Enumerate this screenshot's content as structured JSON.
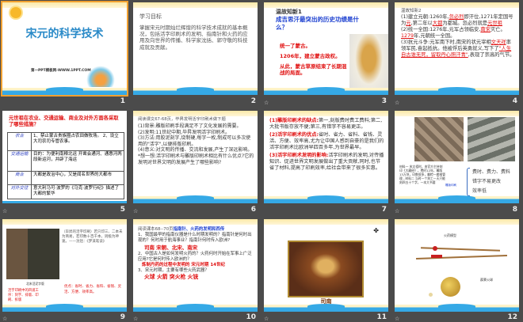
{
  "slides": [
    {
      "number": "1",
      "title": "宋元的科学技术",
      "subtitle": "第一PPT模板网-WWW.1PPT.COM"
    },
    {
      "number": "2",
      "bullets": [
        "学习目标",
        "掌握宋元时期灿烂辉煌的科学技术成就的基本概况，包括活字印刷术的发明、指南针和火药的应用及向世界的传播、科学家沈括、郭守敬的科技成就及贡献。"
      ]
    },
    {
      "number": "3",
      "heading": "温故知新1",
      "question": "成吉思汗最突出的历史功绩是什么？",
      "bullets": [
        "统一了蒙古。",
        "1206年，建立蒙古政权。",
        "从此，蒙古草原结束了长期混战的局面。"
      ]
    },
    {
      "number": "4",
      "heading": "温故知新2",
      "p1": "(1)建立元朝:1260年,",
      "a1": "忽必烈",
      "p1b": "即汗位,1271年定国号为",
      "a2": "元",
      "p1c": ",第二年以",
      "a3": "大都",
      "p1d": "为都城。忽必烈就是",
      "a4": "元世祖",
      "p2": "(2)统一全国:1276年,元军占领临安,",
      "a5": "南宋",
      "p2b": "灭亡。",
      "a6": "1279",
      "p2c": "年,元朝统一全国。",
      "p3": "(3)抗元斗争:元军南下时,南宋的状元宰相",
      "a7": "文天祥",
      "p3b": "率领军民,奋起抵抗。他被俘后英勇就义,写下了",
      "a8": "\"人生自古谁无死，留取丹心照汗青\"",
      "p3c": ",表现了崇高的气节。"
    },
    {
      "number": "5",
      "question": "元世祖在农业、交通运输、商业及对外方面各采取了哪些措施？",
      "rows": [
        {
          "head": "农业",
          "text": "1、禁止蒙古贵族圈占农田做牧场。 2、设立大司农司专管农事。"
        },
        {
          "head": "交通运输",
          "text": "目的：为便利南粮北运 开凿会通河、通惠河两段新运河，并辟了海运"
        },
        {
          "head": "商业",
          "text": "大都是政治中心，又是闻名世界的大都市"
        },
        {
          "head": "对外交往",
          "text": "意大利马可·波罗的《马克·波罗行纪》描述了大都的繁华"
        }
      ]
    },
    {
      "number": "6",
      "intro": "阅读课文67-68页，毕昇发明活字印刷术做下题",
      "items": [
        "(1)背景:雕版印刷手段满足不了文化发展的需要。",
        "(2)发明:11世纪中期,毕昇发明活字印刷术。",
        "(3)方法:用胶泥刻字,烧制硬,每字一枚,制成可以多次使用的\"活字\",以便排版印刷。",
        "(4)意义:对文明的传播、交流和发展,产生了深远影响。",
        "*想一想:活字印刷术与雕版印刷术相比有什么优点?它的发明对世界文明的发展产生了哪些影响?"
      ]
    },
    {
      "number": "7",
      "items": [
        {
          "label": "(1)雕版印刷术的缺点:",
          "text": "第一,刻版费时费工费料;第二,大批书版存放不便;第三,有错字不容易更正。"
        },
        {
          "label": "(2)活字印刷术的优点:",
          "text": "省时、省力、省料、省钱、灵活、方便、效率高,尤为让中国人感到自豪的是我们的活字印刷术比欧洲早四百多年,为世界最早。"
        },
        {
          "label": "(3)活字印刷术发明的影响:",
          "text": "活字印刷术的发明,对传播知识、促进世界文明发展做出了重大贡献,同时,也节省了材料,提高了印刷效率,给社会带来了很多实惠。"
        }
      ]
    },
    {
      "number": "8",
      "caption": "材料一 宋太祖时，由官方主持刻印《大藏经》，费时12年，雕版13万块，印数很多，翻检一套难管理...材料二 当时一个刻工一天只能刻四五十个字，一本大书要",
      "label": "雕版印刷",
      "points": [
        "费时、费力、费料",
        "错字不易更改",
        "效率低"
      ]
    },
    {
      "number": "9",
      "quote": "（毕昇的活字印刷）若只印三、二本未为简易，若印数十百千本，则极为神速。——沈括：《梦溪笔谈》",
      "photo_caption": "北宋活泥字版",
      "left": "活字印刷中的四道工序：刻字、排版、印刷、拆版",
      "right": "优点：省时、省力、省料、省钱、灵活、方便、效率高。"
    },
    {
      "number": "10",
      "intro": "阅读课本68--70页",
      "intro_hl": "指南针、火药的发明和西传",
      "q1": "1、我国最早的指南仪器是什么时期发明的？指南针是何时出现的？何时用于航海事业？指南针何时传入欧洲?",
      "a1": "司南 宋朝、北宋、南宋",
      "q2": "2、中国古人是如何发明火药的？火药何时开始在军事上广泛应用?它是何时传入欧洲的？",
      "a2": "炼制丹药的过程中发明的  宋元时期  14世纪",
      "q3": "3、宋元时期，主要有哪些火药武器？",
      "a3": "火球 火箭 突火枪 火铳"
    },
    {
      "number": "11",
      "caption": "司南"
    },
    {
      "number": "12",
      "label1": "火药模型",
      "label2": "蒺藜火球"
    }
  ]
}
